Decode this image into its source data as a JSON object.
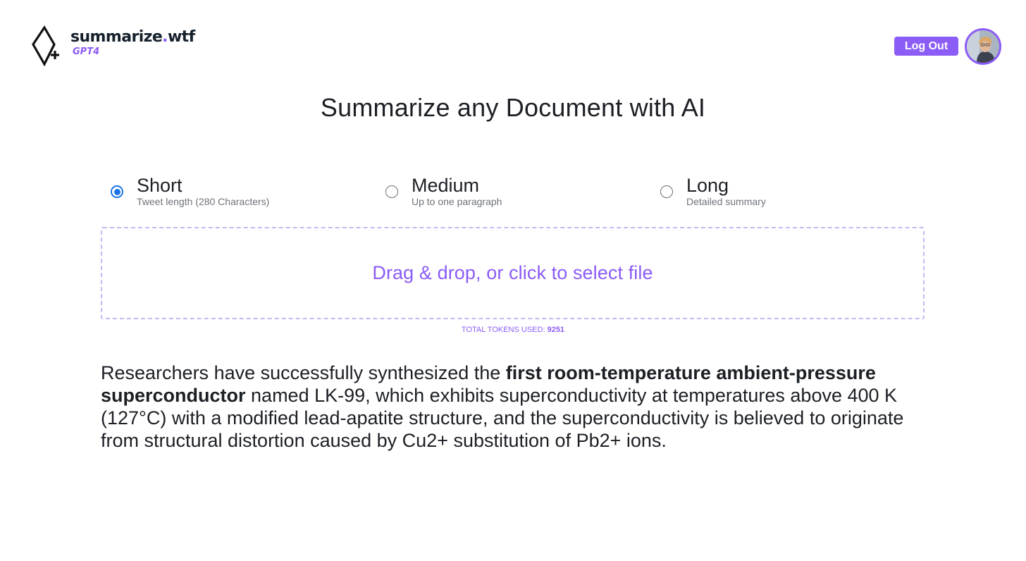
{
  "header": {
    "brand_name": "summarize",
    "brand_dot": ".",
    "brand_tld": "wtf",
    "brand_model": "GPT4",
    "logout_label": "Log Out",
    "accent_color": "#8b5cf6"
  },
  "main": {
    "title": "Summarize any Document with AI",
    "options": [
      {
        "label": "Short",
        "description": "Tweet length (280 Characters)",
        "selected": true
      },
      {
        "label": "Medium",
        "description": "Up to one paragraph",
        "selected": false
      },
      {
        "label": "Long",
        "description": "Detailed summary",
        "selected": false
      }
    ],
    "dropzone_text": "Drag & drop, or click to select file",
    "tokens_label": "TOTAL TOKENS USED:",
    "tokens_value": "9251",
    "summary": {
      "before": "Researchers have successfully synthesized the ",
      "bold": "first room-temperature ambient-pressure superconductor",
      "after": " named LK-99, which exhibits superconductivity at temperatures above 400 K (127°C) with a modified lead-apatite structure, and the superconductivity is believed to originate from structural distortion caused by Cu2+ substitution of Pb2+ ions."
    }
  },
  "icons": {
    "logo": "diamond-plus-icon",
    "avatar": "user-avatar"
  }
}
